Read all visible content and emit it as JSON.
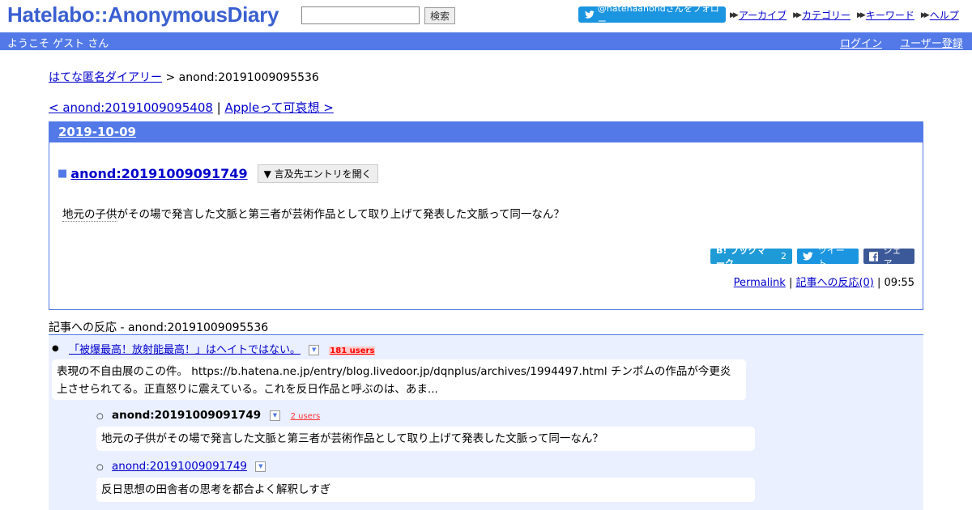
{
  "header": {
    "logo": "Hatelabo::AnonymousDiary",
    "search_placeholder": "",
    "search_button": "検索",
    "follow_button": "@hatenaanondさんをフォロー",
    "links": [
      "アーカイブ",
      "カテゴリー",
      "キーワード",
      "ヘルプ"
    ]
  },
  "navbar": {
    "welcome": "ようこそ ゲスト さん",
    "login": "ログイン",
    "register": "ユーザー登録"
  },
  "breadcrumb": {
    "root": "はてな匿名ダイアリー",
    "separator": " > ",
    "current": "anond:20191009095536"
  },
  "prevnext": {
    "prev": "< anond:20191009095408",
    "separator": " | ",
    "next": "Appleって可哀想 >"
  },
  "entry": {
    "date": "2019-10-09",
    "title": "anond:20191009091749",
    "open_button": "▼ 言及先エントリを開く",
    "body_keyword": "地元の子供",
    "body_rest": "がその場で発言した文脈と第三者が芸術作品として取り上げて発表した文脈って同一なん？",
    "bookmark_label": "B! ブックマーク",
    "bookmark_count": "2",
    "tweet_label": "ツイート",
    "share_label": "シェア",
    "permalink": "Permalink",
    "reaction_link": "記事への反応(0)",
    "time": "09:55"
  },
  "reactions": {
    "title": "記事への反応 - anond:20191009095536",
    "items": [
      {
        "title": "「被爆最高！放射能最高！」はヘイトではない。",
        "users": "181 users",
        "body": "表現の不自由展のこの件。 https://b.hatena.ne.jp/entry/blog.livedoor.jp/dqnplus/archives/1994497.html チンポムの作品が今更炎上させられてる。正直怒りに震えている。これを反日作品と呼ぶのは、あま..."
      },
      {
        "title": "anond:20191009091749",
        "users": "2 users",
        "body": "地元の子供がその場で発言した文脈と第三者が芸術作品として取り上げて発表した文脈って同一なん？"
      },
      {
        "title": "anond:20191009091749",
        "body": "反日思想の田舎者の思考を都合よく解釈しすぎ"
      }
    ]
  },
  "colors": {
    "accent": "#5279e7",
    "link": "#0000cc",
    "reaction_bg": "#eaf0ff",
    "hatena_bookmark": "#1e9ad6",
    "twitter": "#1b95e0",
    "facebook": "#3b5998"
  }
}
